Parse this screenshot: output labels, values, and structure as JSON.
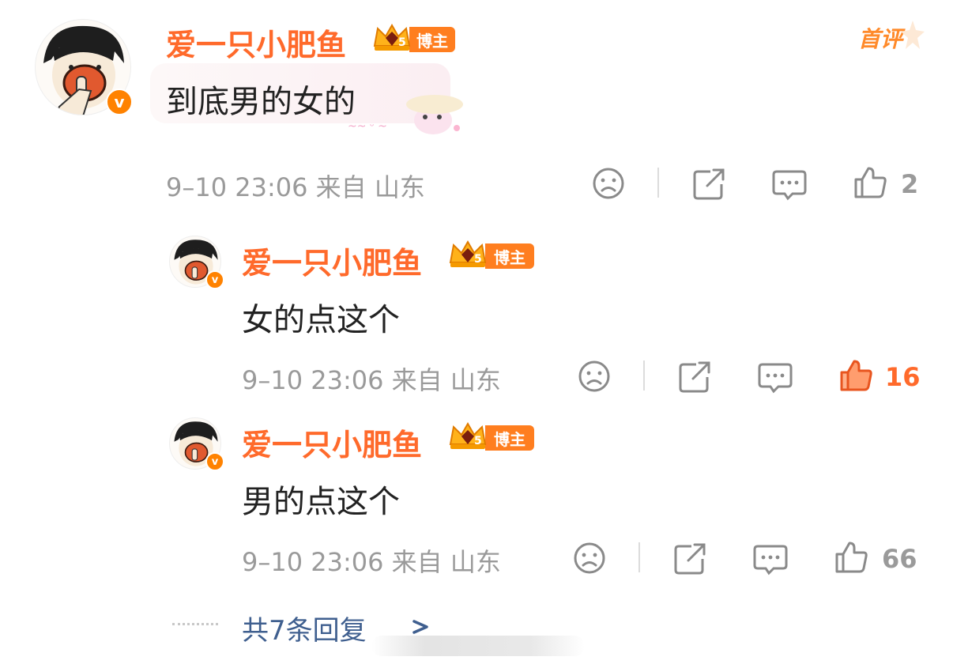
{
  "first_comment_tag": "首评",
  "comments": [
    {
      "username": "爱一只小肥鱼",
      "badge_label": "博主",
      "badge_level": "5",
      "verified": "v",
      "content": "到底男的女的",
      "meta": "9–10 23:06 来自 山东",
      "likes": "2",
      "liked": false
    },
    {
      "username": "爱一只小肥鱼",
      "badge_label": "博主",
      "badge_level": "5",
      "verified": "v",
      "content": "女的点这个",
      "meta": "9–10 23:06 来自 山东",
      "likes": "16",
      "liked": true
    },
    {
      "username": "爱一只小肥鱼",
      "badge_label": "博主",
      "badge_level": "5",
      "verified": "v",
      "content": "男的点这个",
      "meta": "9–10 23:06 来自 山东",
      "likes": "66",
      "liked": false
    }
  ],
  "more_replies": "共7条回复",
  "more_chevron": ">",
  "colors": {
    "username": "#ff6a2b",
    "badge": "#ff7e1f",
    "meta": "#9a9a9a",
    "liked": "#ff6a2b",
    "more_link": "#3f5f8f"
  },
  "icons": [
    "sad-face-icon",
    "share-icon",
    "comment-icon",
    "thumbs-up-icon",
    "crown-badge-icon",
    "chevron-right-icon"
  ]
}
